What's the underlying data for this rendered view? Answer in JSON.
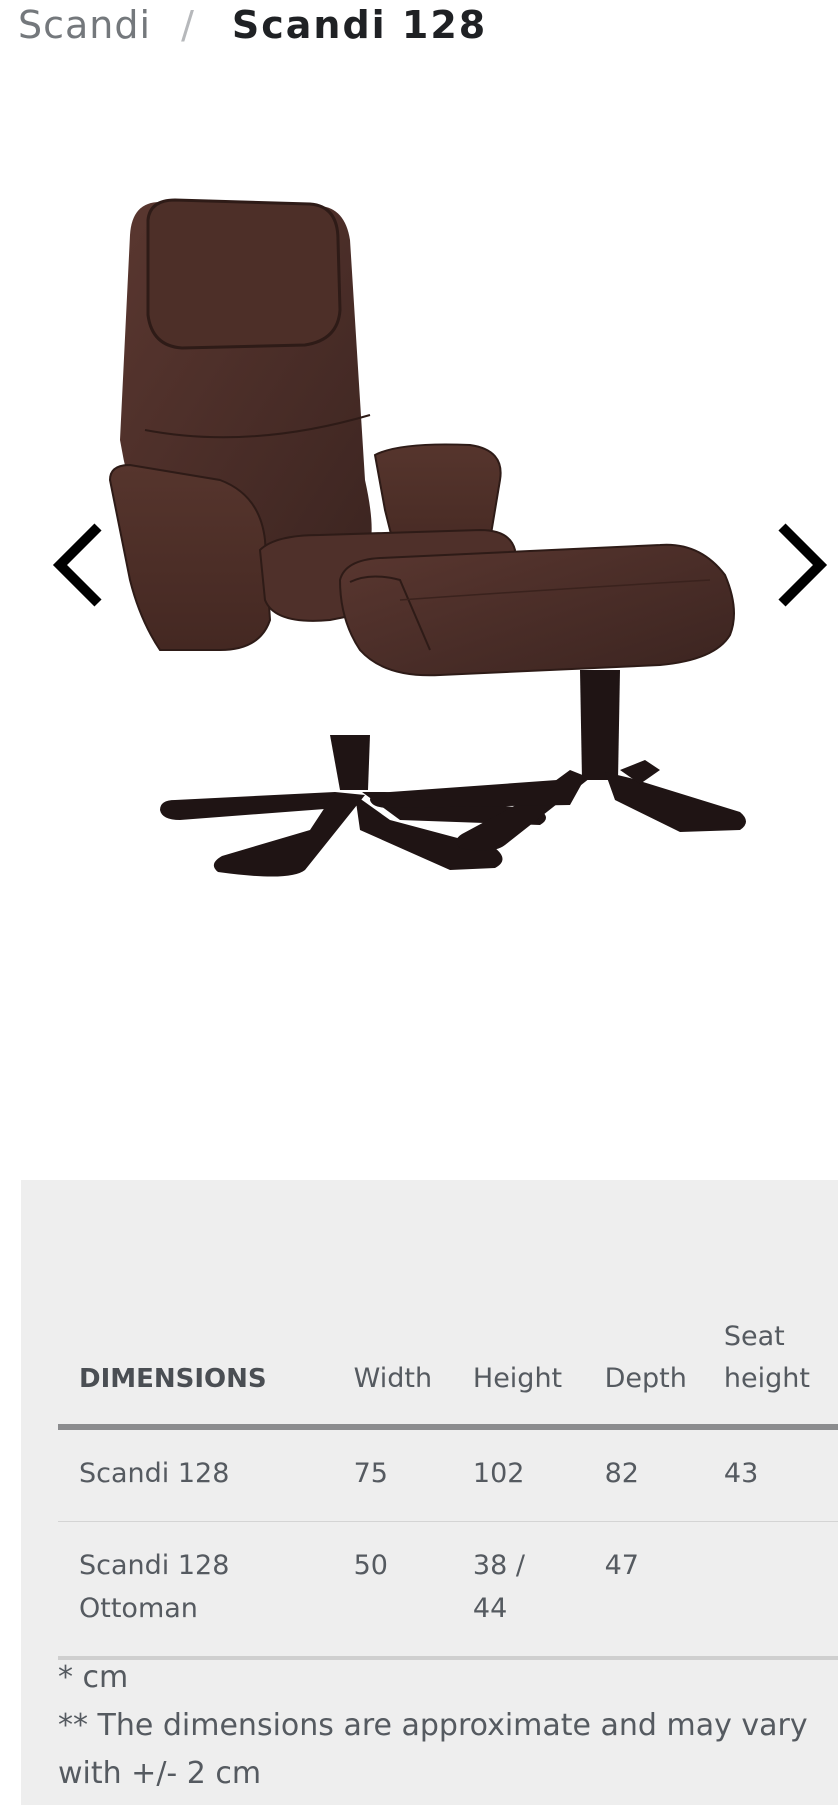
{
  "breadcrumb": {
    "parent": "Scandi",
    "separator": "/",
    "current": "Scandi 128"
  },
  "gallery": {
    "prev_icon": "chevron-left-icon",
    "next_icon": "chevron-right-icon",
    "image_alt": "Scandi 128 brown leather recliner with ottoman"
  },
  "dimensions": {
    "headers": [
      "DIMENSIONS",
      "Width",
      "Height",
      "Depth",
      "Seat height"
    ],
    "rows": [
      [
        "Scandi 128",
        "75",
        "102",
        "82",
        "43"
      ],
      [
        "Scandi 128 Ottoman",
        "50",
        "38 / 44",
        "47",
        ""
      ]
    ],
    "notes": [
      "* cm",
      "** The dimensions are approximate and may vary with +/- 2 cm"
    ]
  },
  "colors": {
    "panel_background": "#eeeeee",
    "leather": "#4a2b24",
    "base": "#1c1212"
  }
}
